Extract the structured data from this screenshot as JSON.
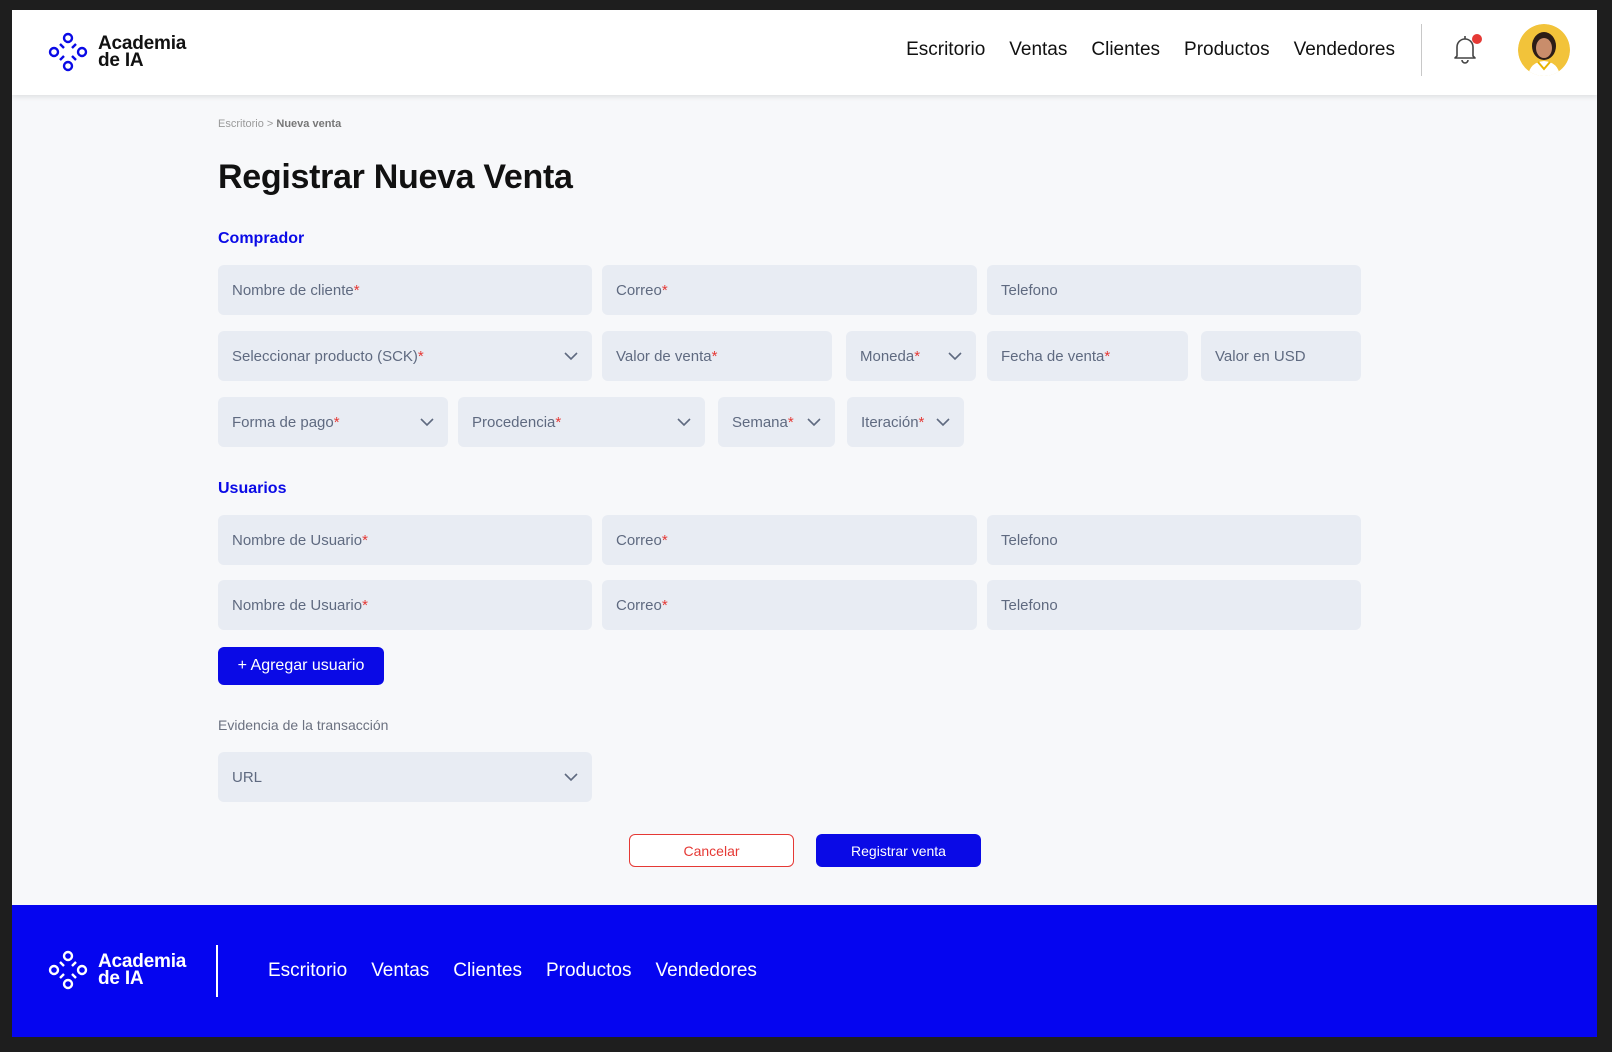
{
  "brand": {
    "name_line1": "Academia",
    "name_line2": "de IA"
  },
  "nav": {
    "items": [
      "Escritorio",
      "Ventas",
      "Clientes",
      "Productos",
      "Vendedores"
    ]
  },
  "breadcrumb": {
    "parent": "Escritorio",
    "separator": " > ",
    "current": "Nueva venta"
  },
  "title": {
    "light": "Registrar ",
    "bold": "Nueva Venta"
  },
  "buyer": {
    "section_title": "Comprador",
    "client_name": {
      "label": "Nombre  de cliente",
      "required": "*"
    },
    "email": {
      "label": "Correo",
      "required": "*"
    },
    "phone": {
      "label": "Telefono"
    },
    "product": {
      "label": "Seleccionar producto (SCK)",
      "required": "*"
    },
    "sale_value": {
      "label": "Valor de venta",
      "required": "*"
    },
    "currency": {
      "label": "Moneda",
      "required": "*"
    },
    "sale_date": {
      "label": "Fecha de venta",
      "required": "*"
    },
    "usd_value": {
      "label": "Valor en USD"
    },
    "payment_method": {
      "label": "Forma de pago",
      "required": "*"
    },
    "source": {
      "label": "Procedencia",
      "required": "*"
    },
    "week": {
      "label": "Semana",
      "required": "*"
    },
    "iteration": {
      "label": "Iteración",
      "required": "*"
    }
  },
  "users": {
    "section_title": "Usuarios",
    "rows": [
      {
        "name": "Nombre  de Usuario",
        "email": "Correo",
        "phone": "Telefono",
        "required": "*"
      },
      {
        "name": "Nombre  de Usuario",
        "email": "Correo",
        "phone": "Telefono",
        "required": "*"
      }
    ],
    "add_button": "+ Agregar usuario"
  },
  "evidence": {
    "label": "Evidencia de la transacción",
    "select_value": "URL"
  },
  "actions": {
    "cancel": "Cancelar",
    "submit": "Registrar venta"
  },
  "colors": {
    "accent": "#0a0ae6",
    "footer": "#0505f0",
    "required": "#e53935",
    "field_bg": "#e8ecf3",
    "page_bg": "#f7f8fa"
  },
  "icons": {
    "logo": "atom-logo-icon",
    "bell": "bell-icon",
    "chevron": "chevron-down-icon"
  }
}
